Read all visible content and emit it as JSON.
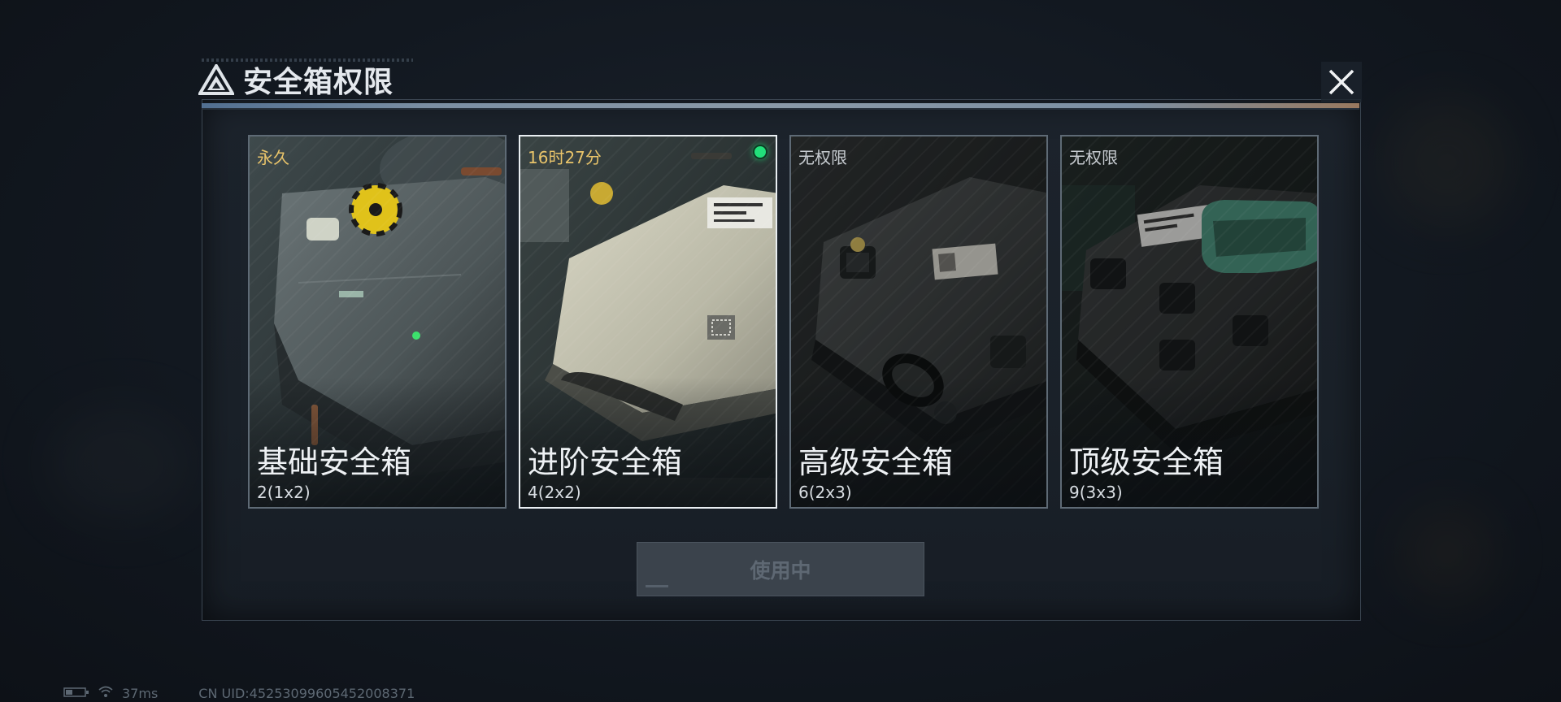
{
  "dialog": {
    "title": "安全箱权限",
    "use_button_label": "使用中"
  },
  "cards": [
    {
      "tag": "永久",
      "tag_color": "#e9c46a",
      "name": "基础安全箱",
      "capacity": "2(1x2)",
      "selected": false,
      "locked": false
    },
    {
      "tag": "16时27分",
      "tag_color": "#e9c46a",
      "name": "进阶安全箱",
      "capacity": "4(2x2)",
      "selected": true,
      "active": true,
      "locked": false
    },
    {
      "tag": "无权限",
      "tag_color": "#c7ccd1",
      "name": "高级安全箱",
      "capacity": "6(2x3)",
      "selected": false,
      "locked": true
    },
    {
      "tag": "无权限",
      "tag_color": "#c7ccd1",
      "name": "顶级安全箱",
      "capacity": "9(3x3)",
      "selected": false,
      "locked": true
    }
  ],
  "status": {
    "ping": "37ms",
    "uid": "CN UID:45253099605452008371",
    "icons": [
      "battery-icon",
      "wifi-icon"
    ]
  },
  "colors": {
    "active_dot": "#22e07a",
    "accent_gold": "#e9c46a"
  }
}
